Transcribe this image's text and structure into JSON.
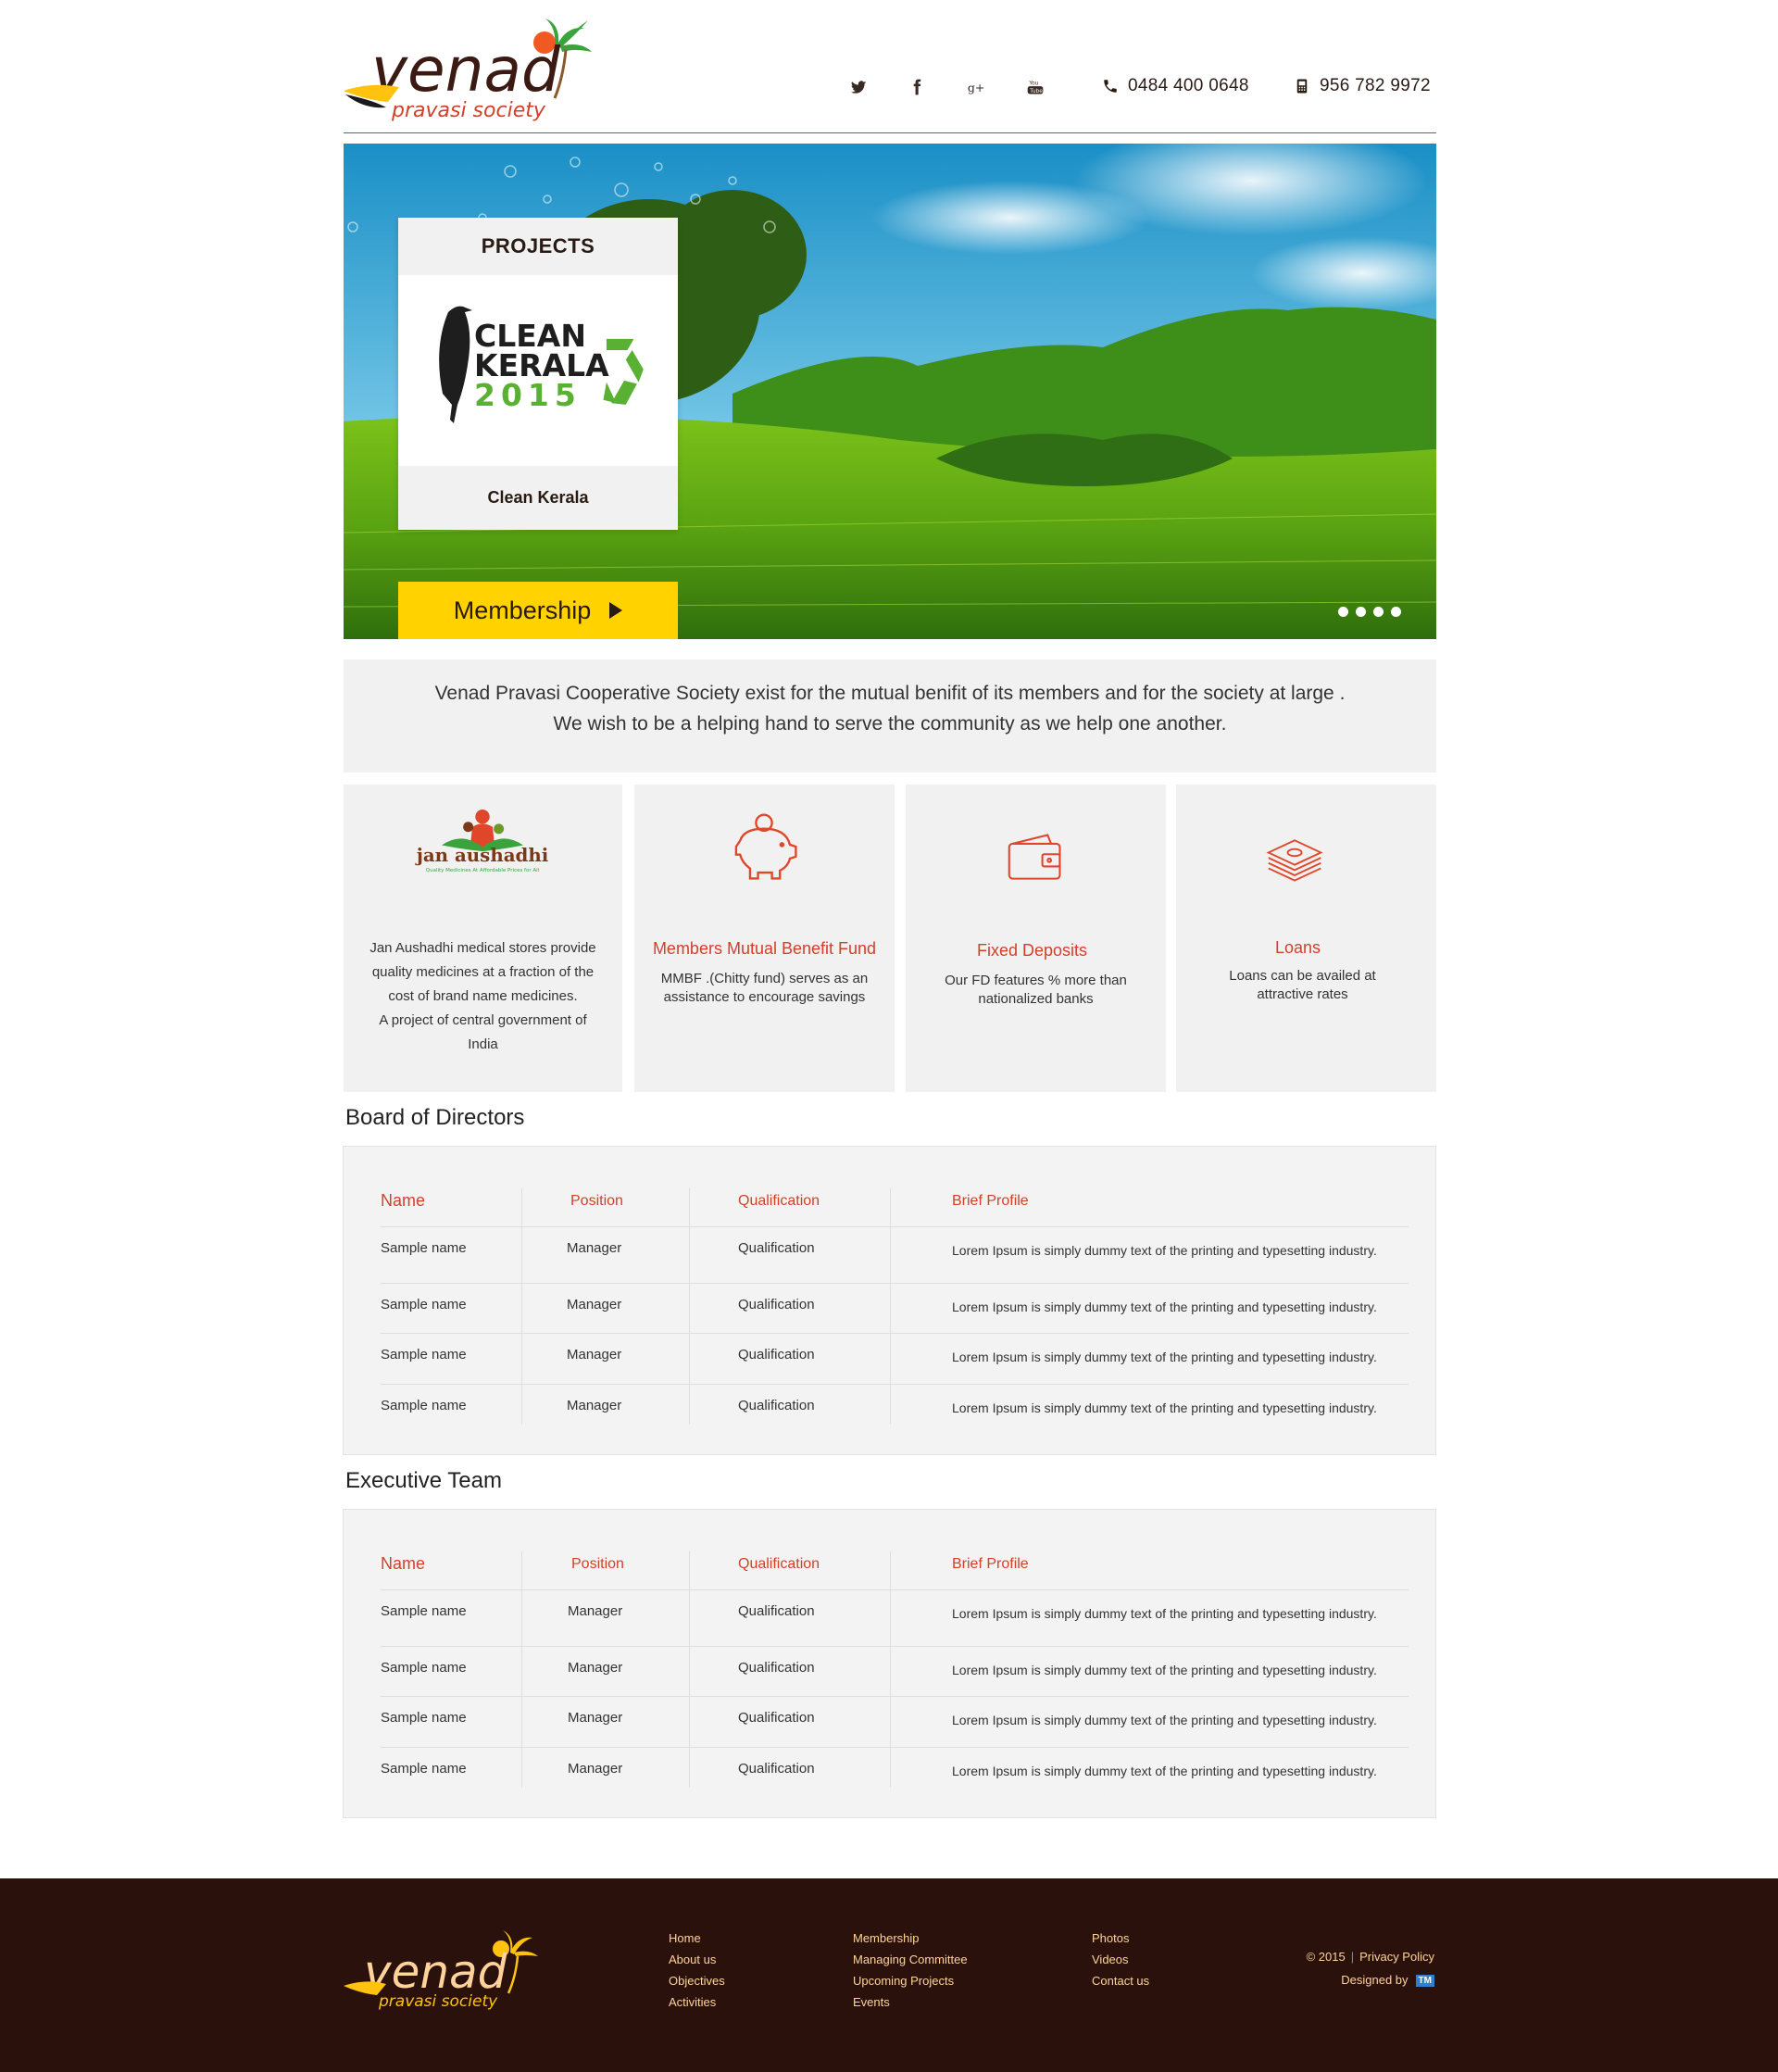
{
  "header": {
    "logo_main": "venad",
    "logo_sub": "pravasi society",
    "social": [
      "twitter-icon",
      "facebook-icon",
      "google-plus-icon",
      "youtube-icon"
    ],
    "phone_label": "0484 400 0648",
    "mobile_label": "956 782 9972"
  },
  "hero": {
    "projects_title": "PROJECTS",
    "project_logo_line1": "CLEAN",
    "project_logo_line2": "KERALA",
    "project_logo_year": "2015",
    "project_name": "Clean Kerala",
    "membership_label": "Membership",
    "slide_count": 4
  },
  "intro": {
    "line1": "Venad Pravasi Cooperative Society exist for the mutual benifit of its members and for the society at large .",
    "line2": "We wish to be a helping hand to serve the community as we help one another."
  },
  "features": {
    "jan_aushadhi": {
      "logo_text": "jan aushadhi",
      "logo_tagline": "Quality Medicines At Affordable Prices for All",
      "text1": "Jan Aushadhi medical stores provide",
      "text2": "quality medicines at a fraction of the",
      "text3": "cost of brand name medicines.",
      "text4": "A project of central government of",
      "text5": "India"
    },
    "mmbf": {
      "title": "Members Mutual Benefit Fund",
      "text1": "MMBF .(Chitty fund) serves as an",
      "text2": "assistance to encourage savings"
    },
    "fd": {
      "title": "Fixed Deposits",
      "text1": "Our FD features % more than",
      "text2": "nationalized banks"
    },
    "loans": {
      "title": "Loans",
      "text1": "Loans can be availed at",
      "text2": "attractive rates"
    }
  },
  "board": {
    "title": "Board of Directors",
    "headers": [
      "Name",
      "Position",
      "Qualification",
      "Brief Profile"
    ],
    "rows": [
      [
        "Sample name",
        "Manager",
        "Qualification",
        "Lorem Ipsum is simply dummy text of the printing and typesetting industry."
      ],
      [
        "Sample name",
        "Manager",
        "Qualification",
        "Lorem Ipsum is simply dummy text of the printing and typesetting industry."
      ],
      [
        "Sample name",
        "Manager",
        "Qualification",
        "Lorem Ipsum is simply dummy text of the printing and typesetting industry."
      ],
      [
        "Sample name",
        "Manager",
        "Qualification",
        "Lorem Ipsum is simply dummy text of the printing and typesetting industry."
      ]
    ]
  },
  "executive": {
    "title": "Executive Team",
    "headers": [
      "Name",
      "Position",
      "Qualification",
      "Brief Profile"
    ],
    "rows": [
      [
        "Sample name",
        "Manager",
        "Qualification",
        "Lorem Ipsum is simply dummy text of the printing and typesetting industry."
      ],
      [
        "Sample name",
        "Manager",
        "Qualification",
        "Lorem Ipsum is simply dummy text of the printing and typesetting industry."
      ],
      [
        "Sample name",
        "Manager",
        "Qualification",
        "Lorem Ipsum is simply dummy text of the printing and typesetting industry."
      ],
      [
        "Sample name",
        "Manager",
        "Qualification",
        "Lorem Ipsum is simply dummy text of the printing and typesetting industry."
      ]
    ]
  },
  "footer": {
    "col1": [
      "Home",
      "About us",
      "Objectives",
      "Activities"
    ],
    "col2": [
      "Membership",
      "Managing Committee",
      "Upcoming Projects",
      "Events"
    ],
    "col3": [
      "Photos",
      "Videos",
      "Contact us"
    ],
    "copyright": "© 2015",
    "privacy": "Privacy Policy",
    "designed_by": "Designed by",
    "designer_badge": "TM"
  },
  "colors": {
    "accent": "#d2402a",
    "dark_brown": "#2a110c",
    "yellow": "#ffd200",
    "panel": "#f1f1f1"
  }
}
